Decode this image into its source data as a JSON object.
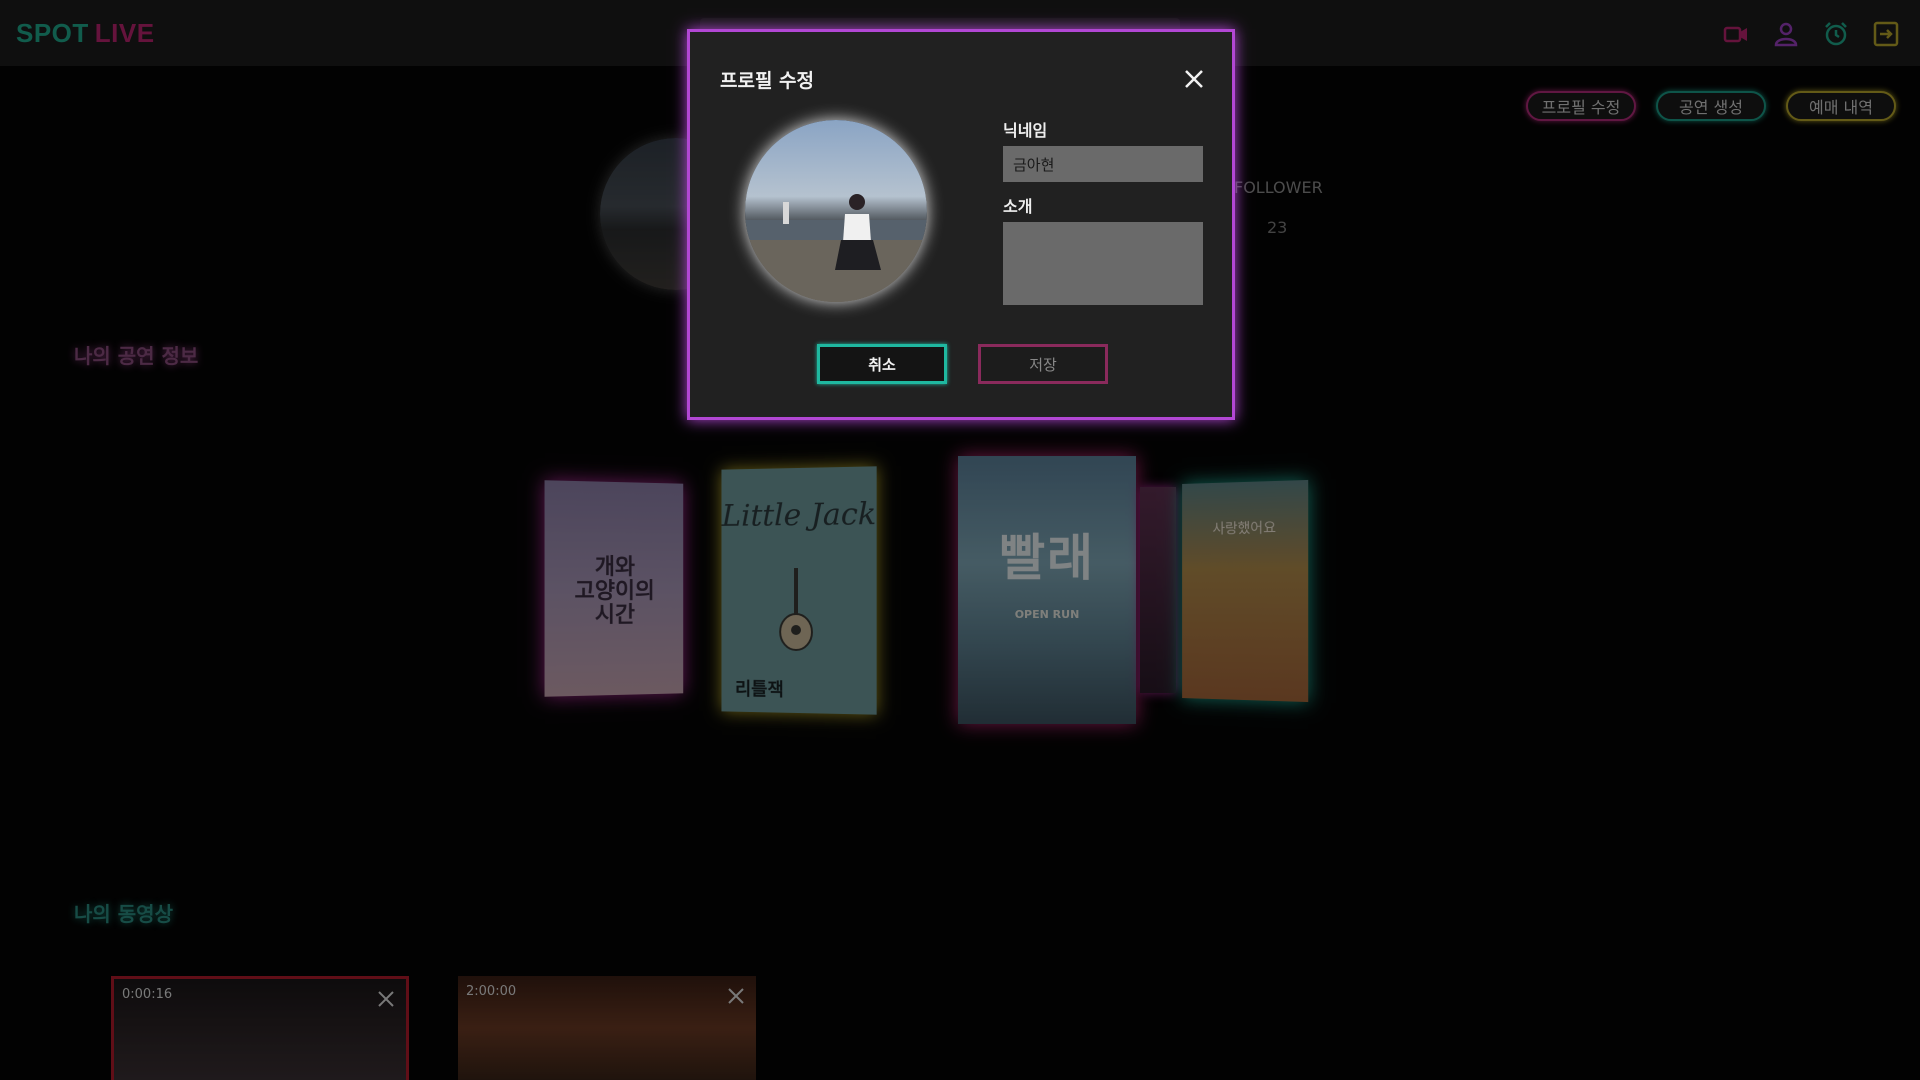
{
  "app": {
    "logo_part1": "SPOT",
    "logo_part2": "LIVE"
  },
  "header": {
    "icons": [
      "video-camera-icon",
      "user-icon",
      "alarm-clock-icon",
      "logout-icon"
    ]
  },
  "profile": {
    "actions": {
      "edit_label": "프로필 수정",
      "create_label": "공연 생성",
      "booking_label": "예매 내역"
    },
    "follower_label": "FOLLOWER",
    "follower_count": "23"
  },
  "sections": {
    "shows_title": "나의 공연 정보",
    "videos_title": "나의 동영상"
  },
  "posters": [
    {
      "title": "개와\n고양이의\n시간"
    },
    {
      "script": "Little Jack",
      "title": "리틀잭"
    },
    {
      "title": "빨래",
      "subtitle": "OPEN RUN"
    },
    {
      "title": ""
    },
    {
      "title": "사랑했어요"
    }
  ],
  "videos": [
    {
      "time": "0:00:16"
    },
    {
      "time": "2:00:00"
    }
  ],
  "modal": {
    "title": "프로필 수정",
    "nickname_label": "닉네임",
    "nickname_value": "금아현",
    "intro_label": "소개",
    "intro_value": "",
    "cancel_label": "취소",
    "save_label": "저장"
  },
  "colors": {
    "modal_border": "#b247d4",
    "cancel_border": "#1fb8a0",
    "save_border": "#8a2a5c",
    "logo_spot": "#1fa88a",
    "logo_live": "#b8246e"
  }
}
